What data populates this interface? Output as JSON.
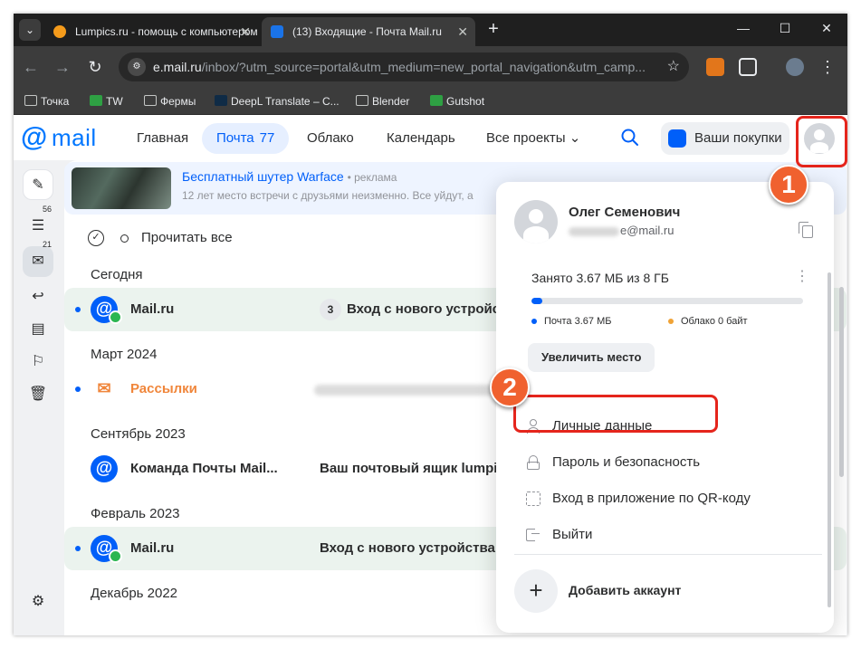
{
  "browser": {
    "tabs": [
      {
        "title": "Lumpics.ru - помощь с компьютером",
        "active": false
      },
      {
        "title": "(13) Входящие - Почта Mail.ru",
        "active": true
      }
    ],
    "address": {
      "host": "e.mail.ru",
      "path": "/inbox/?utm_source=portal&utm_medium=new_portal_navigation&utm_camp..."
    },
    "bookmarks": [
      "Точка",
      "TW",
      "Фермы",
      "DeepL Translate – С...",
      "Blender",
      "Gutshot"
    ]
  },
  "header": {
    "logo_at": "@",
    "logo_word": "mail",
    "nav": [
      {
        "label": "Главная"
      },
      {
        "label": "Почта",
        "count": "77"
      },
      {
        "label": "Облако"
      },
      {
        "label": "Календарь"
      },
      {
        "label": "Все проекты"
      }
    ],
    "purchases_label": "Ваши покупки"
  },
  "sidebar": {
    "folders_count": "56",
    "inbox_count": "21"
  },
  "promo": {
    "title": "Бесплатный шутер Warface",
    "ad_tag": "• реклама",
    "text": "12 лет место встречи с друзьями неизменно. Все уйдут, а"
  },
  "mail": {
    "read_all": "Прочитать все",
    "sections": [
      "Сегодня",
      "Март 2024",
      "Сентябрь 2023",
      "Февраль 2023",
      "Декабрь 2022"
    ],
    "rows": [
      {
        "sender": "Mail.ru",
        "thread_count": "3",
        "subject": "Вход с нового устройства"
      },
      {
        "sender": "Рассылки",
        "subject": ""
      },
      {
        "sender": "Команда Почты Mail...",
        "subject": "Ваш почтовый ящик lumpics"
      },
      {
        "sender": "Mail.ru",
        "subject": "Вход с нового устройства"
      }
    ]
  },
  "account_menu": {
    "name": "Олег Семенович",
    "email_suffix": "e@mail.ru",
    "storage_label": "Занято 3.67 МБ из 8 ГБ",
    "storage_used_fraction": 0.004,
    "legend_mail": "Почта 3.67 МБ",
    "legend_cloud": "Облако 0 байт",
    "increase_button": "Увеличить место",
    "items": [
      "Личные данные",
      "Пароль и безопасность",
      "Вход в приложение по QR-коду",
      "Выйти"
    ],
    "add_account": "Добавить аккаунт"
  },
  "annotations": {
    "step1": "1",
    "step2": "2"
  },
  "colors": {
    "accent": "#005ff9",
    "callout": "#f0612f",
    "highlight_box": "#e5251c",
    "cloud_legend": "#f0a336"
  }
}
